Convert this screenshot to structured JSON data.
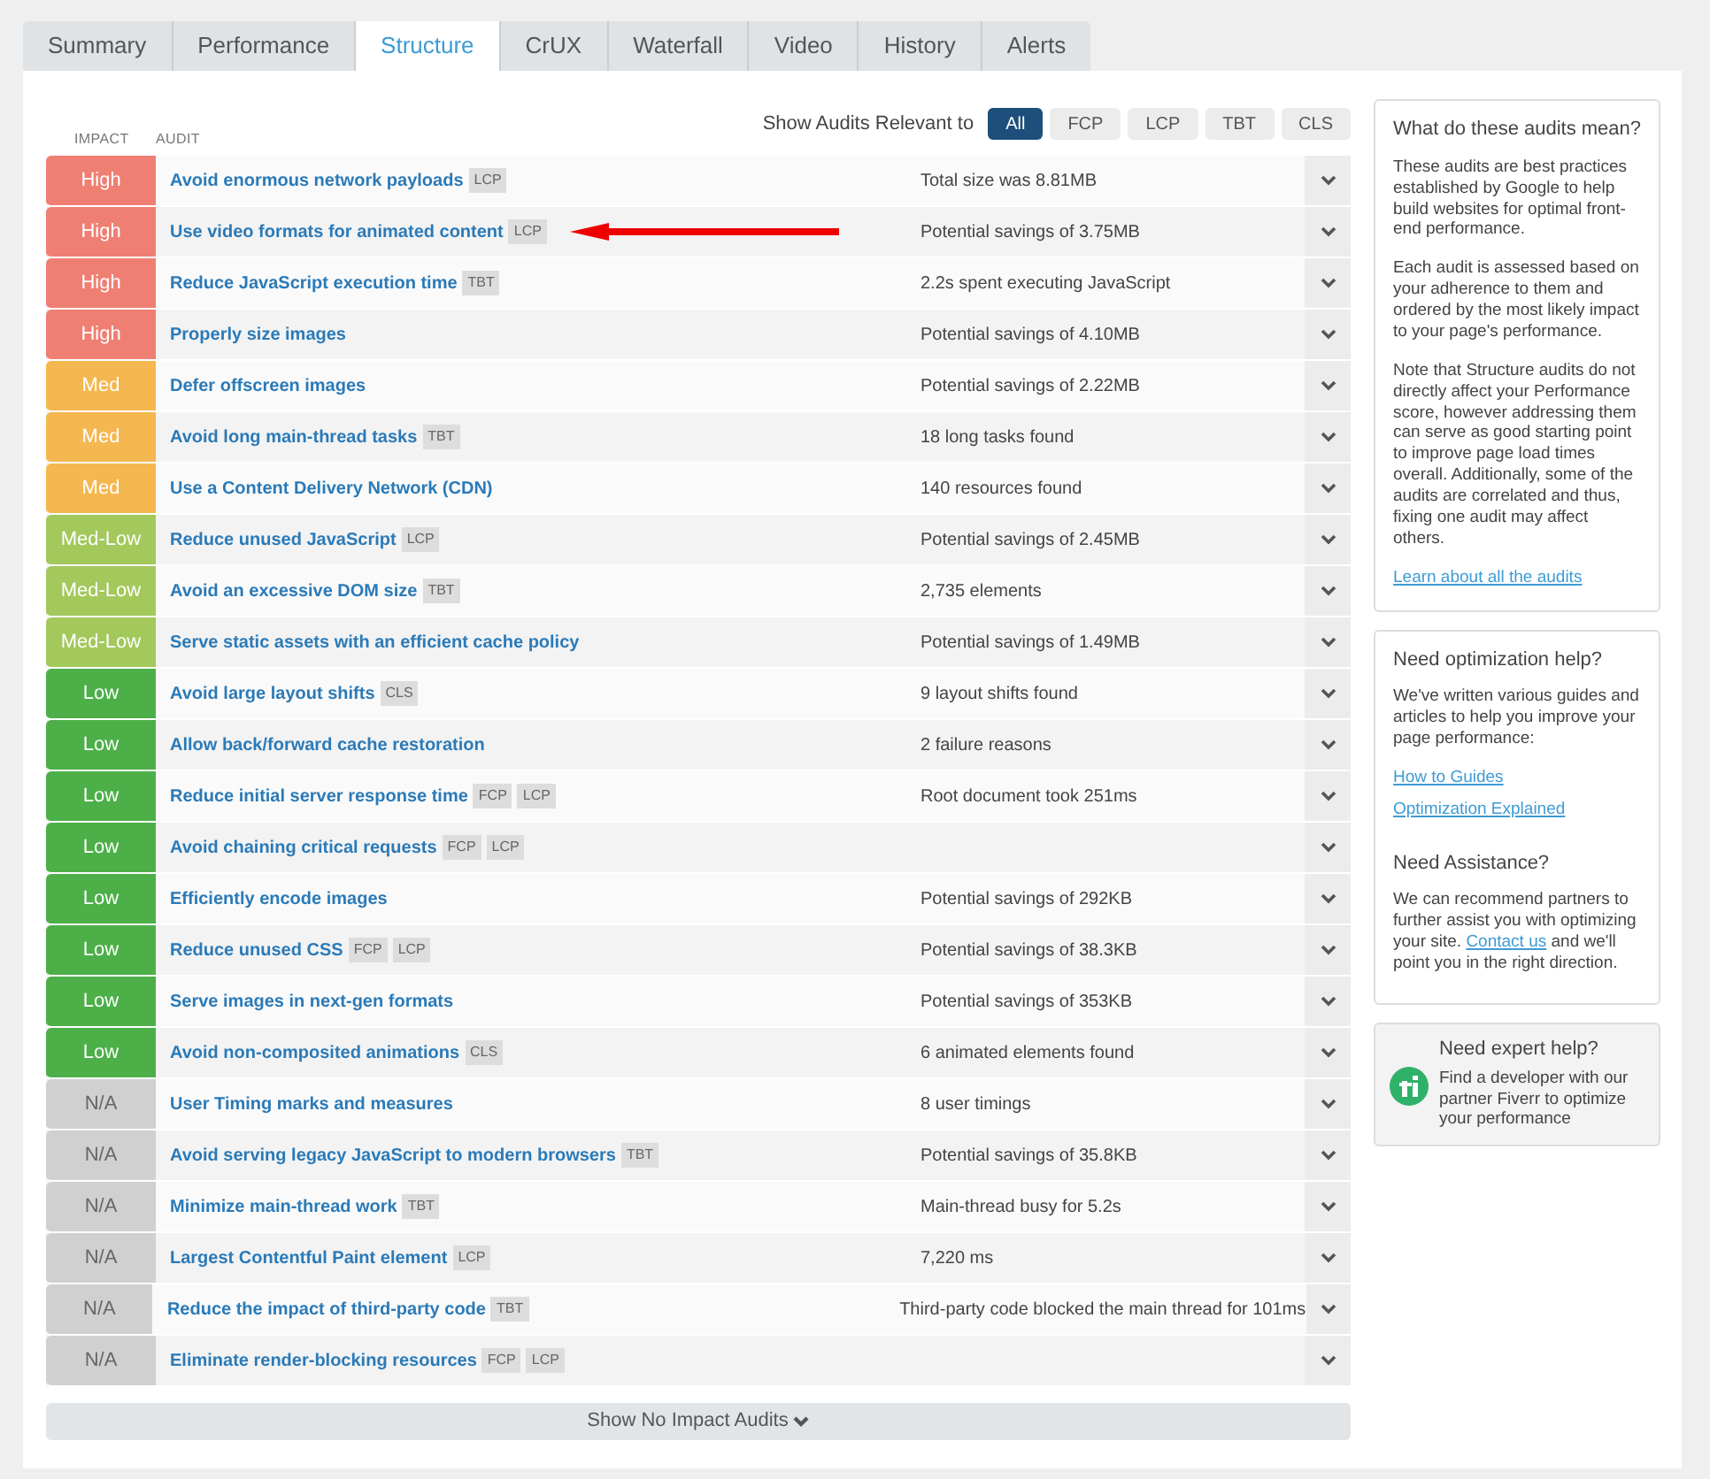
{
  "tabs": [
    {
      "label": "Summary",
      "selected": false
    },
    {
      "label": "Performance",
      "selected": false
    },
    {
      "label": "Structure",
      "selected": true
    },
    {
      "label": "CrUX",
      "selected": false
    },
    {
      "label": "Waterfall",
      "selected": false
    },
    {
      "label": "Video",
      "selected": false
    },
    {
      "label": "History",
      "selected": false
    },
    {
      "label": "Alerts",
      "selected": false
    }
  ],
  "filter": {
    "label": "Show Audits Relevant to",
    "options": [
      {
        "label": "All",
        "selected": true
      },
      {
        "label": "FCP",
        "selected": false
      },
      {
        "label": "LCP",
        "selected": false
      },
      {
        "label": "TBT",
        "selected": false
      },
      {
        "label": "CLS",
        "selected": false
      }
    ]
  },
  "table": {
    "columns": [
      "IMPACT",
      "AUDIT"
    ],
    "rows": [
      {
        "impact": "High",
        "color": "#f07f73",
        "audit": "Avoid enormous network payloads",
        "tags": [
          "LCP"
        ],
        "detail": "Total size was 8.81MB",
        "annotation_arrow": false
      },
      {
        "impact": "High",
        "color": "#f07f73",
        "audit": "Use video formats for animated content",
        "tags": [
          "LCP"
        ],
        "detail": "Potential savings of 3.75MB",
        "annotation_arrow": true
      },
      {
        "impact": "High",
        "color": "#f07f73",
        "audit": "Reduce JavaScript execution time",
        "tags": [
          "TBT"
        ],
        "detail": "2.2s spent executing JavaScript",
        "annotation_arrow": false
      },
      {
        "impact": "High",
        "color": "#f07f73",
        "audit": "Properly size images",
        "tags": [],
        "detail": "Potential savings of 4.10MB",
        "annotation_arrow": false
      },
      {
        "impact": "Med",
        "color": "#f5b750",
        "audit": "Defer offscreen images",
        "tags": [],
        "detail": "Potential savings of 2.22MB",
        "annotation_arrow": false
      },
      {
        "impact": "Med",
        "color": "#f5b750",
        "audit": "Avoid long main-thread tasks",
        "tags": [
          "TBT"
        ],
        "detail": "18 long tasks found",
        "annotation_arrow": false
      },
      {
        "impact": "Med",
        "color": "#f5b750",
        "audit": "Use a Content Delivery Network (CDN)",
        "tags": [],
        "detail": "140 resources found",
        "annotation_arrow": false
      },
      {
        "impact": "Med-Low",
        "color": "#a3c85c",
        "audit": "Reduce unused JavaScript",
        "tags": [
          "LCP"
        ],
        "detail": "Potential savings of 2.45MB",
        "annotation_arrow": false
      },
      {
        "impact": "Med-Low",
        "color": "#a3c85c",
        "audit": "Avoid an excessive DOM size",
        "tags": [
          "TBT"
        ],
        "detail": "2,735 elements",
        "annotation_arrow": false
      },
      {
        "impact": "Med-Low",
        "color": "#a3c85c",
        "audit": "Serve static assets with an efficient cache policy",
        "tags": [],
        "detail": "Potential savings of 1.49MB",
        "annotation_arrow": false
      },
      {
        "impact": "Low",
        "color": "#4caf48",
        "audit": "Avoid large layout shifts",
        "tags": [
          "CLS"
        ],
        "detail": "9 layout shifts found",
        "annotation_arrow": false
      },
      {
        "impact": "Low",
        "color": "#4caf48",
        "audit": "Allow back/forward cache restoration",
        "tags": [],
        "detail": "2 failure reasons",
        "annotation_arrow": false
      },
      {
        "impact": "Low",
        "color": "#4caf48",
        "audit": "Reduce initial server response time",
        "tags": [
          "FCP",
          "LCP"
        ],
        "detail": "Root document took 251ms",
        "annotation_arrow": false
      },
      {
        "impact": "Low",
        "color": "#4caf48",
        "audit": "Avoid chaining critical requests",
        "tags": [
          "FCP",
          "LCP"
        ],
        "annotation_arrow": false
      },
      {
        "impact": "Low",
        "color": "#4caf48",
        "audit": "Efficiently encode images",
        "tags": [],
        "detail": "Potential savings of 292KB",
        "annotation_arrow": false
      },
      {
        "impact": "Low",
        "color": "#4caf48",
        "audit": "Reduce unused CSS",
        "tags": [
          "FCP",
          "LCP"
        ],
        "detail": "Potential savings of 38.3KB",
        "annotation_arrow": false
      },
      {
        "impact": "Low",
        "color": "#4caf48",
        "audit": "Serve images in next-gen formats",
        "tags": [],
        "detail": "Potential savings of 353KB",
        "annotation_arrow": false
      },
      {
        "impact": "Low",
        "color": "#4caf48",
        "audit": "Avoid non-composited animations",
        "tags": [
          "CLS"
        ],
        "detail": "6 animated elements found",
        "annotation_arrow": false
      },
      {
        "impact": "N/A",
        "color": "#d0d0d0",
        "audit": "User Timing marks and measures",
        "tags": [],
        "detail": "8 user timings",
        "annotation_arrow": false
      },
      {
        "impact": "N/A",
        "color": "#d0d0d0",
        "audit": "Avoid serving legacy JavaScript to modern browsers",
        "tags": [
          "TBT"
        ],
        "detail": "Potential savings of 35.8KB",
        "annotation_arrow": false
      },
      {
        "impact": "N/A",
        "color": "#d0d0d0",
        "audit": "Minimize main-thread work",
        "tags": [
          "TBT"
        ],
        "detail": "Main-thread busy for 5.2s",
        "annotation_arrow": false
      },
      {
        "impact": "N/A",
        "color": "#d0d0d0",
        "audit": "Largest Contentful Paint element",
        "tags": [
          "LCP"
        ],
        "detail": "7,220 ms",
        "annotation_arrow": false
      },
      {
        "impact": "N/A",
        "color": "#d0d0d0",
        "audit": "Reduce the impact of third-party code",
        "tags": [
          "TBT"
        ],
        "detail": "Third-party code blocked the main thread for 101ms",
        "annotation_arrow": false
      },
      {
        "impact": "N/A",
        "color": "#d0d0d0",
        "audit": "Eliminate render-blocking resources",
        "tags": [
          "FCP",
          "LCP"
        ],
        "annotation_arrow": false
      }
    ]
  },
  "show_more_button": "Show No Impact Audits",
  "sidebar": [
    {
      "kind": "info",
      "title": "What do these audits mean?",
      "paragraphs": [
        "These audits are best practices established by Google to help build websites for optimal front-end performance.",
        "Each audit is assessed based on your adherence to them and ordered by the most likely impact to your page's performance.",
        "Note that Structure audits do not directly affect your Performance score, however addressing them can serve as good starting point to improve page load times overall. Additionally, some of the audits are correlated and thus, fixing one audit may affect others."
      ],
      "links": [
        "Learn about all the audits"
      ]
    },
    {
      "kind": "info",
      "title": "Need optimization help?",
      "paragraphs": [
        "We've written various guides and articles to help you improve your page performance:"
      ],
      "links": [
        "How to Guides",
        "Optimization Explained"
      ],
      "subtitle": "Need Assistance?",
      "sub_text_before": "We can recommend partners to further assist you with optimizing your site.",
      "sub_link": "Contact us",
      "sub_text_after": "and we'll point you in the right direction."
    },
    {
      "kind": "promo",
      "title": "Need expert help?",
      "paragraphs": [
        "Find a developer with our partner Fiverr to optimize your performance"
      ]
    }
  ]
}
